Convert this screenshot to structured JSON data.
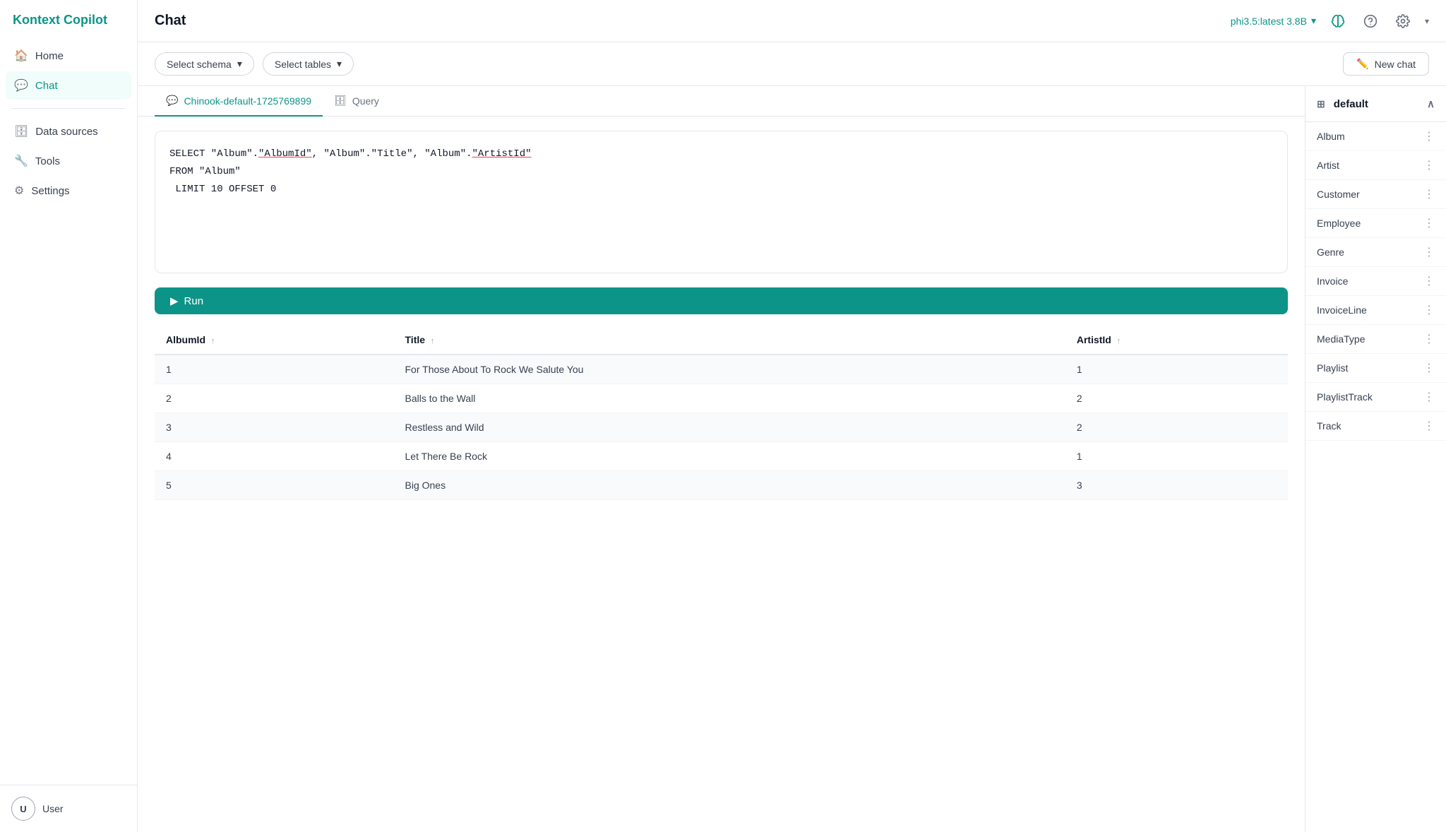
{
  "app": {
    "name_plain": "Kontext",
    "name_accent": "Copilot"
  },
  "sidebar": {
    "items": [
      {
        "id": "home",
        "label": "Home",
        "icon": "🏠",
        "active": false
      },
      {
        "id": "chat",
        "label": "Chat",
        "icon": "💬",
        "active": true
      },
      {
        "id": "data-sources",
        "label": "Data sources",
        "icon": "🗄",
        "active": false
      },
      {
        "id": "tools",
        "label": "Tools",
        "icon": "🔧",
        "active": false
      },
      {
        "id": "settings",
        "label": "Settings",
        "icon": "⚙",
        "active": false
      }
    ],
    "user": {
      "initials": "U",
      "name": "User"
    }
  },
  "topbar": {
    "title": "Chat",
    "model": "phi3.5:latest 3.8B"
  },
  "toolbar": {
    "select_schema_label": "Select schema",
    "select_tables_label": "Select tables",
    "new_chat_label": "New chat"
  },
  "tabs": [
    {
      "id": "chat",
      "label": "Chinook-default-1725769899",
      "active": true
    },
    {
      "id": "query",
      "label": "Query",
      "active": false
    }
  ],
  "query": {
    "sql": "SELECT \"Album\".\"AlbumId\", \"Album\".\"Title\", \"Album\".\"ArtistId\"\nFROM \"Album\"\nLIMIT 10 OFFSET 0"
  },
  "run_button": {
    "label": "Run"
  },
  "results": {
    "columns": [
      {
        "id": "AlbumId",
        "label": "AlbumId"
      },
      {
        "id": "Title",
        "label": "Title"
      },
      {
        "id": "ArtistId",
        "label": "ArtistId"
      }
    ],
    "rows": [
      {
        "AlbumId": 1,
        "Title": "For Those About To Rock We Salute You",
        "ArtistId": 1
      },
      {
        "AlbumId": 2,
        "Title": "Balls to the Wall",
        "ArtistId": 2
      },
      {
        "AlbumId": 3,
        "Title": "Restless and Wild",
        "ArtistId": 2
      },
      {
        "AlbumId": 4,
        "Title": "Let There Be Rock",
        "ArtistId": 1
      },
      {
        "AlbumId": 5,
        "Title": "Big Ones",
        "ArtistId": 3
      }
    ]
  },
  "right_panel": {
    "schema": "default",
    "tables": [
      {
        "name": "Album"
      },
      {
        "name": "Artist"
      },
      {
        "name": "Customer"
      },
      {
        "name": "Employee"
      },
      {
        "name": "Genre"
      },
      {
        "name": "Invoice"
      },
      {
        "name": "InvoiceLine"
      },
      {
        "name": "MediaType"
      },
      {
        "name": "Playlist"
      },
      {
        "name": "PlaylistTrack"
      },
      {
        "name": "Track"
      }
    ]
  }
}
